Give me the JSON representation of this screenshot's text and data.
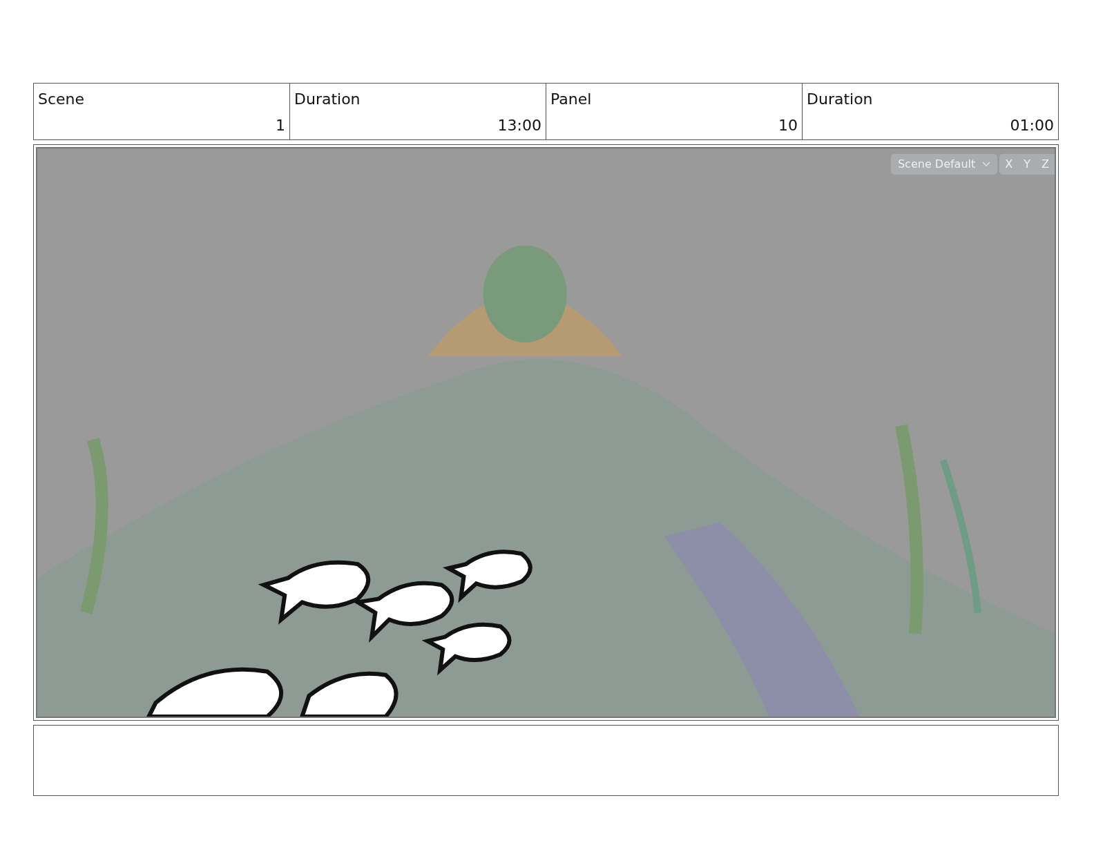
{
  "header": {
    "labels": [
      "Scene",
      "Duration",
      "Panel",
      "Duration"
    ],
    "values": [
      "1",
      "13:00",
      "10",
      "01:00"
    ]
  },
  "viewport": {
    "view_menu": "Scene Default",
    "axis_buttons": [
      "X",
      "Y",
      "Z"
    ]
  }
}
